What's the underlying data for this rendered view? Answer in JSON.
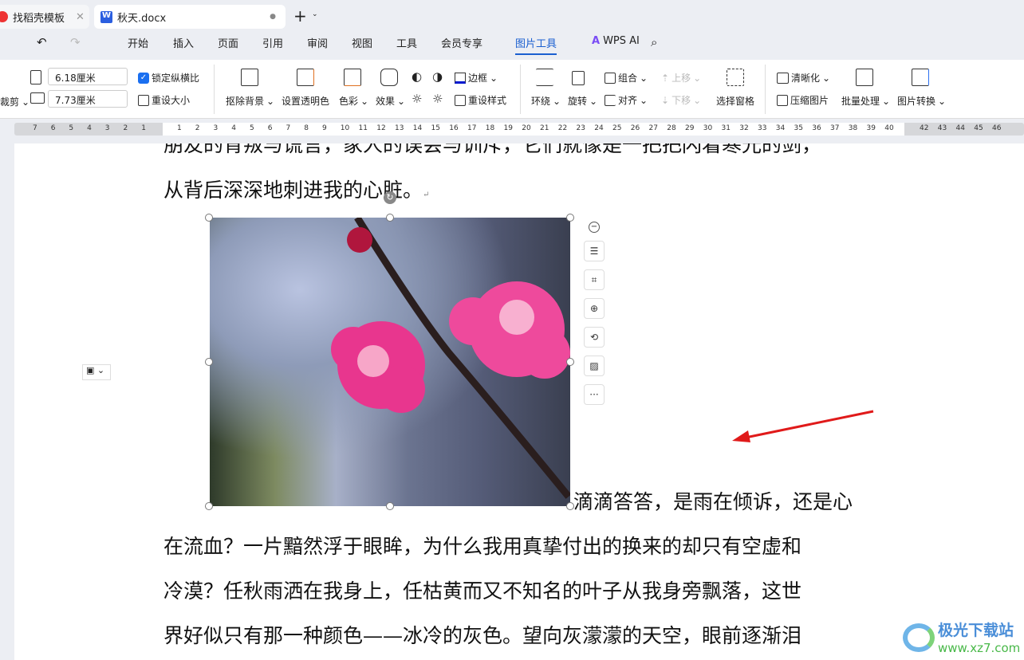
{
  "tabs": [
    {
      "label": "找稻壳模板",
      "close": "✕"
    },
    {
      "label": "秋天.docx",
      "dot": "●"
    }
  ],
  "new_tab": "+",
  "menu": [
    "开始",
    "插入",
    "页面",
    "引用",
    "审阅",
    "视图",
    "工具",
    "会员专享",
    "图片工具"
  ],
  "active_menu": "图片工具",
  "wps_ai": "WPS AI",
  "ribbon": {
    "crop": "裁剪",
    "width": "6.18厘米",
    "height": "7.73厘米",
    "lock_ratio": "锁定纵横比",
    "lock_checked": true,
    "reset_size": "重设大小",
    "remove_bg": "抠除背景",
    "set_transparent": "设置透明色",
    "color": "色彩",
    "effects": "效果",
    "border": "边框",
    "reset_style": "重设样式",
    "wrap": "环绕",
    "rotate": "旋转",
    "group": "组合",
    "align": "对齐",
    "bring_forward": "上移",
    "send_backward": "下移",
    "selection_pane": "选择窗格",
    "sharpen": "清晰化",
    "compress": "压缩图片",
    "batch": "批量处理",
    "convert": "图片转换"
  },
  "ruler_left": [
    "7",
    "6",
    "5",
    "4",
    "3",
    "2",
    "1"
  ],
  "ruler_right": [
    "1",
    "2",
    "3",
    "4",
    "5",
    "6",
    "7",
    "8",
    "9",
    "10",
    "11",
    "12",
    "13",
    "14",
    "15",
    "16",
    "17",
    "18",
    "19",
    "20",
    "21",
    "22",
    "23",
    "24",
    "25",
    "26",
    "27",
    "28",
    "29",
    "30",
    "31",
    "32",
    "33",
    "34",
    "35",
    "36",
    "37",
    "38",
    "39",
    "40"
  ],
  "ruler_end": [
    "42",
    "43",
    "44",
    "45",
    "46"
  ],
  "doc": {
    "lines": [
      "朋友的背叛与谎言，家人的误会与训斥，它们就像是一把把闪着寒光的剑，",
      "从背后深深地刺进我的心脏。",
      "滴滴答答，是雨在倾诉，还是心",
      "在流血？一片黯然浮于眼眸，为什么我用真挚付出的换来的却只有空虚和",
      "冷漠？任秋雨洒在我身上，任枯黄而又不知名的叶子从我身旁飘落，这世",
      "界好似只有那一种颜色——冰冷的灰色。望向灰濛濛的天空，眼前逐渐泪"
    ],
    "para_mark": "↵"
  },
  "float_toolbar": [
    "wrap-icon",
    "crop-icon",
    "zoom-icon",
    "rotate-icon",
    "replace-image-icon",
    "more-icon"
  ],
  "more": "···",
  "watermark": {
    "name": "极光下载站",
    "url": "www.xz7.com"
  },
  "colors": {
    "accent": "#1a5fd0",
    "arrow": "#e01a1a"
  }
}
